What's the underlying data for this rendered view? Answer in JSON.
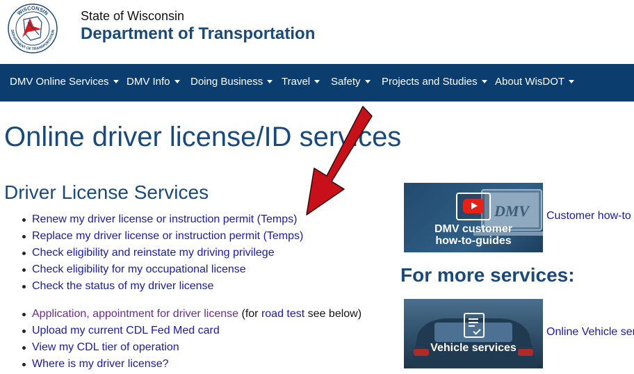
{
  "header": {
    "logo_text_top": "WISCONSIN",
    "logo_text_bottom": "DEPARTMENT OF TRANSPORTATION",
    "state_label": "State of Wisconsin",
    "department_label": "Department of Transportation"
  },
  "nav": {
    "items": [
      {
        "label": "DMV Online Services"
      },
      {
        "label": "DMV Info"
      },
      {
        "label": "Doing Business"
      },
      {
        "label": "Travel"
      },
      {
        "label": "Safety"
      },
      {
        "label": "Projects and Studies"
      },
      {
        "label": "About WisDOT"
      }
    ]
  },
  "main": {
    "page_title": "Online driver license/ID services",
    "section_title": "Driver License Services",
    "list_group_1": [
      "Renew my driver license or instruction permit (Temps)",
      "Replace my driver license or instruction permit (Temps)",
      "Check eligibility and reinstate my driving privilege",
      "Check eligibility for my occupational license",
      "Check the status of my driver license"
    ],
    "list_group_2": {
      "application_link": "Application, appointment for driver license",
      "application_mid": "(for",
      "road_test_link": "road test",
      "application_end": "see below)",
      "items": [
        "Upload my current CDL Fed Med card",
        "View my CDL tier of operation",
        "Where is my driver license?"
      ]
    }
  },
  "sidebar": {
    "tile1_caption_line1": "DMV customer",
    "tile1_caption_line2": "how-to-guides",
    "tile1_screen_text": "DMV",
    "tile1_link": "Customer how-to",
    "more_services_heading": "For more services:",
    "tile2_caption": "Vehicle services",
    "tile2_link": "Online Vehicle ser"
  },
  "colors": {
    "nav_background": "#0b3e6f",
    "heading_blue": "#1a4a7a",
    "link_blue": "#1a1aa6",
    "visited_purple": "#6a2b8a",
    "annotation_arrow_red": "#c8101a",
    "video_play_red": "#e62117"
  },
  "icons": {
    "logo": "wisdot-seal-logo",
    "nav_dropdown": "caret-down-icon",
    "tile1_play": "play-video-icon",
    "tile2_document": "document-check-icon",
    "annotation": "red-arrow-annotation"
  }
}
